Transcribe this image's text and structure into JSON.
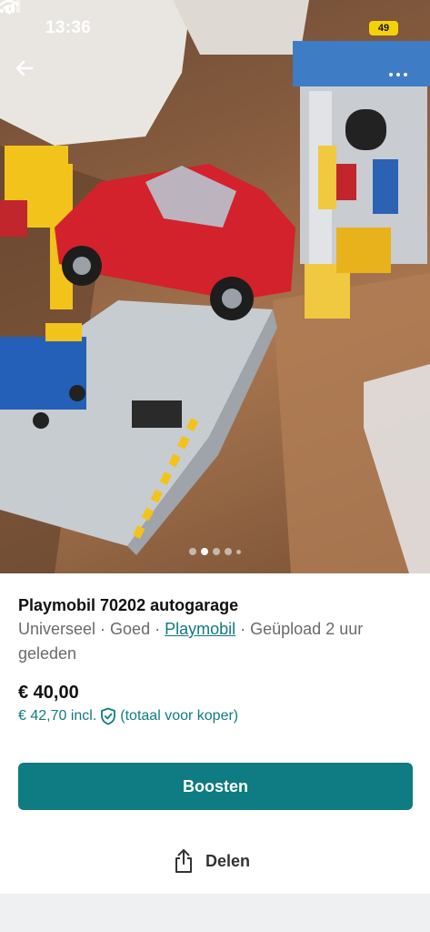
{
  "status": {
    "time": "13:36",
    "battery": "49"
  },
  "icons": {
    "back": "arrow-left-icon",
    "more": "more-dots-icon",
    "share": "share-icon",
    "shield": "shield-check-icon"
  },
  "gallery": {
    "image_count": 5,
    "active_index": 1
  },
  "listing": {
    "title": "Playmobil 70202 autogarage",
    "size": "Universeel",
    "sep1": " · ",
    "condition": "Goed",
    "sep2": " · ",
    "brand": "Playmobil",
    "sep3": " · ",
    "uploaded": "Geüpload 2 uur geleden",
    "price": "€ 40,00",
    "price_incl": "€ 42,70 incl.",
    "price_incl_note": "(totaal voor koper)"
  },
  "actions": {
    "boost_label": "Boosten",
    "share_label": "Delen"
  },
  "colors": {
    "accent": "#0f7b82",
    "battery": "#f4d20a"
  }
}
